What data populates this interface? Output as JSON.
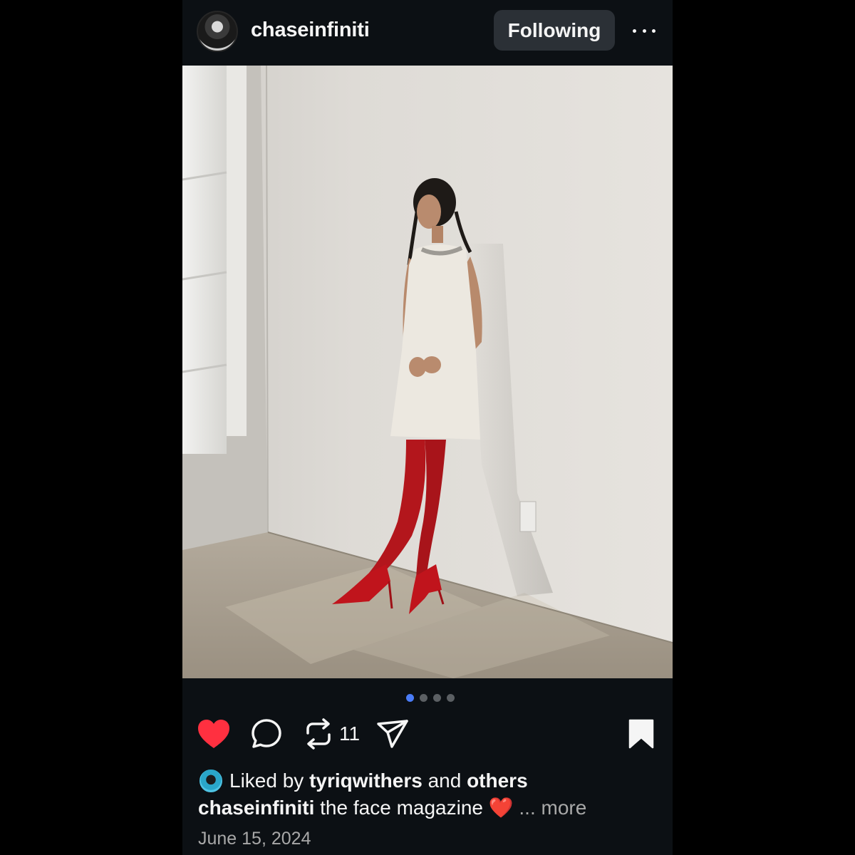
{
  "header": {
    "username": "chaseinfiniti",
    "follow_label": "Following",
    "verified_icon": "verified-badge-icon",
    "more_icon": "more-horizontal-icon"
  },
  "media": {
    "carousel_count": 4,
    "carousel_active_index": 0
  },
  "actions": {
    "liked": true,
    "repost_count": "11",
    "icons": [
      "heart-icon",
      "comment-icon",
      "repost-icon",
      "share-icon",
      "bookmark-icon"
    ]
  },
  "likes": {
    "prefix": "Liked by",
    "user": "tyriqwithers",
    "conjunction": "and",
    "others": "others"
  },
  "caption": {
    "username": "chaseinfiniti",
    "text": "the face magazine",
    "emoji": "❤️",
    "ellipsis": "...",
    "more": "more"
  },
  "date": "June 15, 2024",
  "colors": {
    "background": "#0c1014",
    "accent_blue": "#4a7cf7",
    "like_red": "#ff3040",
    "follow_button": "#2b3036"
  }
}
